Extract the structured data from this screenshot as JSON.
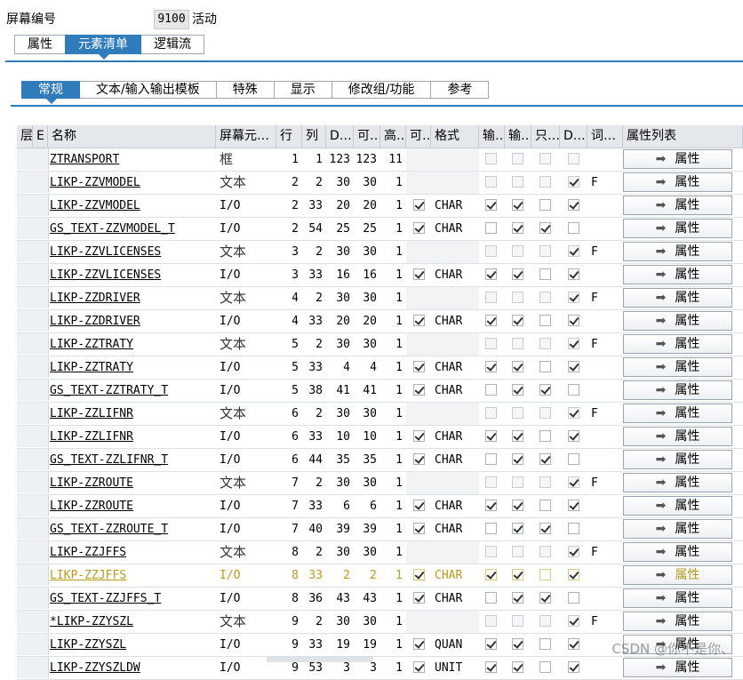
{
  "header": {
    "screen_label": "屏幕编号",
    "screen_number": "9100",
    "status": "活动"
  },
  "top_tabs": [
    "属性",
    "元素清单",
    "逻辑流"
  ],
  "top_active": 1,
  "sub_tabs": [
    "常规",
    "文本/输入输出模板",
    "特殊",
    "显示",
    "修改组/功能",
    "参考"
  ],
  "sub_active": 0,
  "columns": [
    "层",
    "E",
    "名称",
    "屏幕元…",
    "行",
    "列",
    "D…",
    "可…",
    "高…",
    "可…",
    "格式",
    "输…",
    "输…",
    "只…",
    "D…",
    "词…",
    "属性列表"
  ],
  "attr_button_label": "属性",
  "watermark": "CSDN @你不是你、",
  "rows": [
    {
      "name": "ZTRANSPORT",
      "type": "框",
      "row": "1",
      "col": "1",
      "d": "123",
      "v": "123",
      "h": "11",
      "scb": false,
      "fmt": "",
      "c1": false,
      "c2": false,
      "c3": false,
      "c4": false,
      "dict": "",
      "mode": "frame"
    },
    {
      "name": "LIKP-ZZVMODEL",
      "type": "文本",
      "row": "2",
      "col": "2",
      "d": "30",
      "v": "30",
      "h": "1",
      "scb": false,
      "fmt": "",
      "c1": false,
      "c2": false,
      "c3": false,
      "c4": true,
      "dict": "F",
      "mode": "text"
    },
    {
      "name": "LIKP-ZZVMODEL",
      "type": "I/O",
      "row": "2",
      "col": "33",
      "d": "20",
      "v": "20",
      "h": "1",
      "scb": true,
      "fmt": "CHAR",
      "c1": true,
      "c2": true,
      "c3": false,
      "c4": true,
      "dict": "",
      "mode": "io"
    },
    {
      "name": "GS_TEXT-ZZVMODEL_T",
      "type": "I/O",
      "row": "2",
      "col": "54",
      "d": "25",
      "v": "25",
      "h": "1",
      "scb": true,
      "fmt": "CHAR",
      "c1": false,
      "c2": true,
      "c3": true,
      "c4": false,
      "dict": "",
      "mode": "io"
    },
    {
      "name": "LIKP-ZZVLICENSES",
      "type": "文本",
      "row": "3",
      "col": "2",
      "d": "30",
      "v": "30",
      "h": "1",
      "scb": false,
      "fmt": "",
      "c1": false,
      "c2": false,
      "c3": false,
      "c4": true,
      "dict": "F",
      "mode": "text"
    },
    {
      "name": "LIKP-ZZVLICENSES",
      "type": "I/O",
      "row": "3",
      "col": "33",
      "d": "16",
      "v": "16",
      "h": "1",
      "scb": true,
      "fmt": "CHAR",
      "c1": true,
      "c2": true,
      "c3": false,
      "c4": true,
      "dict": "",
      "mode": "io"
    },
    {
      "name": "LIKP-ZZDRIVER",
      "type": "文本",
      "row": "4",
      "col": "2",
      "d": "30",
      "v": "30",
      "h": "1",
      "scb": false,
      "fmt": "",
      "c1": false,
      "c2": false,
      "c3": false,
      "c4": true,
      "dict": "F",
      "mode": "text"
    },
    {
      "name": "LIKP-ZZDRIVER",
      "type": "I/O",
      "row": "4",
      "col": "33",
      "d": "20",
      "v": "20",
      "h": "1",
      "scb": true,
      "fmt": "CHAR",
      "c1": true,
      "c2": true,
      "c3": false,
      "c4": true,
      "dict": "",
      "mode": "io"
    },
    {
      "name": "LIKP-ZZTRATY",
      "type": "文本",
      "row": "5",
      "col": "2",
      "d": "30",
      "v": "30",
      "h": "1",
      "scb": false,
      "fmt": "",
      "c1": false,
      "c2": false,
      "c3": false,
      "c4": true,
      "dict": "F",
      "mode": "text"
    },
    {
      "name": "LIKP-ZZTRATY",
      "type": "I/O",
      "row": "5",
      "col": "33",
      "d": "4",
      "v": "4",
      "h": "1",
      "scb": true,
      "fmt": "CHAR",
      "c1": true,
      "c2": true,
      "c3": false,
      "c4": true,
      "dict": "",
      "mode": "io"
    },
    {
      "name": "GS_TEXT-ZZTRATY_T",
      "type": "I/O",
      "row": "5",
      "col": "38",
      "d": "41",
      "v": "41",
      "h": "1",
      "scb": true,
      "fmt": "CHAR",
      "c1": false,
      "c2": true,
      "c3": true,
      "c4": false,
      "dict": "",
      "mode": "io"
    },
    {
      "name": "LIKP-ZZLIFNR",
      "type": "文本",
      "row": "6",
      "col": "2",
      "d": "30",
      "v": "30",
      "h": "1",
      "scb": false,
      "fmt": "",
      "c1": false,
      "c2": false,
      "c3": false,
      "c4": true,
      "dict": "F",
      "mode": "text"
    },
    {
      "name": "LIKP-ZZLIFNR",
      "type": "I/O",
      "row": "6",
      "col": "33",
      "d": "10",
      "v": "10",
      "h": "1",
      "scb": true,
      "fmt": "CHAR",
      "c1": true,
      "c2": true,
      "c3": false,
      "c4": true,
      "dict": "",
      "mode": "io"
    },
    {
      "name": "GS_TEXT-ZZLIFNR_T",
      "type": "I/O",
      "row": "6",
      "col": "44",
      "d": "35",
      "v": "35",
      "h": "1",
      "scb": true,
      "fmt": "CHAR",
      "c1": false,
      "c2": true,
      "c3": true,
      "c4": false,
      "dict": "",
      "mode": "io"
    },
    {
      "name": "LIKP-ZZROUTE",
      "type": "文本",
      "row": "7",
      "col": "2",
      "d": "30",
      "v": "30",
      "h": "1",
      "scb": false,
      "fmt": "",
      "c1": false,
      "c2": false,
      "c3": false,
      "c4": true,
      "dict": "F",
      "mode": "text"
    },
    {
      "name": "LIKP-ZZROUTE",
      "type": "I/O",
      "row": "7",
      "col": "33",
      "d": "6",
      "v": "6",
      "h": "1",
      "scb": true,
      "fmt": "CHAR",
      "c1": true,
      "c2": true,
      "c3": false,
      "c4": true,
      "dict": "",
      "mode": "io"
    },
    {
      "name": "GS_TEXT-ZZROUTE_T",
      "type": "I/O",
      "row": "7",
      "col": "40",
      "d": "39",
      "v": "39",
      "h": "1",
      "scb": true,
      "fmt": "CHAR",
      "c1": false,
      "c2": true,
      "c3": true,
      "c4": false,
      "dict": "",
      "mode": "io"
    },
    {
      "name": "LIKP-ZZJFFS",
      "type": "文本",
      "row": "8",
      "col": "2",
      "d": "30",
      "v": "30",
      "h": "1",
      "scb": false,
      "fmt": "",
      "c1": false,
      "c2": false,
      "c3": false,
      "c4": true,
      "dict": "F",
      "mode": "text"
    },
    {
      "name": "LIKP-ZZJFFS",
      "type": "I/O",
      "row": "8",
      "col": "33",
      "d": "2",
      "v": "2",
      "h": "1",
      "scb": true,
      "fmt": "CHAR",
      "c1": true,
      "c2": true,
      "c3": false,
      "c4": true,
      "dict": "",
      "mode": "io",
      "hl": true
    },
    {
      "name": "GS_TEXT-ZZJFFS_T",
      "type": "I/O",
      "row": "8",
      "col": "36",
      "d": "43",
      "v": "43",
      "h": "1",
      "scb": true,
      "fmt": "CHAR",
      "c1": false,
      "c2": true,
      "c3": true,
      "c4": false,
      "dict": "",
      "mode": "io"
    },
    {
      "name": "*LIKP-ZZYSZL",
      "type": "文本",
      "row": "9",
      "col": "2",
      "d": "30",
      "v": "30",
      "h": "1",
      "scb": false,
      "fmt": "",
      "c1": false,
      "c2": false,
      "c3": false,
      "c4": true,
      "dict": "F",
      "mode": "text"
    },
    {
      "name": "LIKP-ZZYSZL",
      "type": "I/O",
      "row": "9",
      "col": "33",
      "d": "19",
      "v": "19",
      "h": "1",
      "scb": true,
      "fmt": "QUAN",
      "c1": true,
      "c2": true,
      "c3": false,
      "c4": true,
      "dict": "",
      "mode": "io"
    },
    {
      "name": "LIKP-ZZYSZLDW",
      "type": "I/O",
      "row": "9",
      "col": "53",
      "d": "3",
      "v": "3",
      "h": "1",
      "scb": true,
      "fmt": "UNIT",
      "c1": true,
      "c2": true,
      "c3": false,
      "c4": true,
      "dict": "",
      "mode": "io"
    }
  ]
}
